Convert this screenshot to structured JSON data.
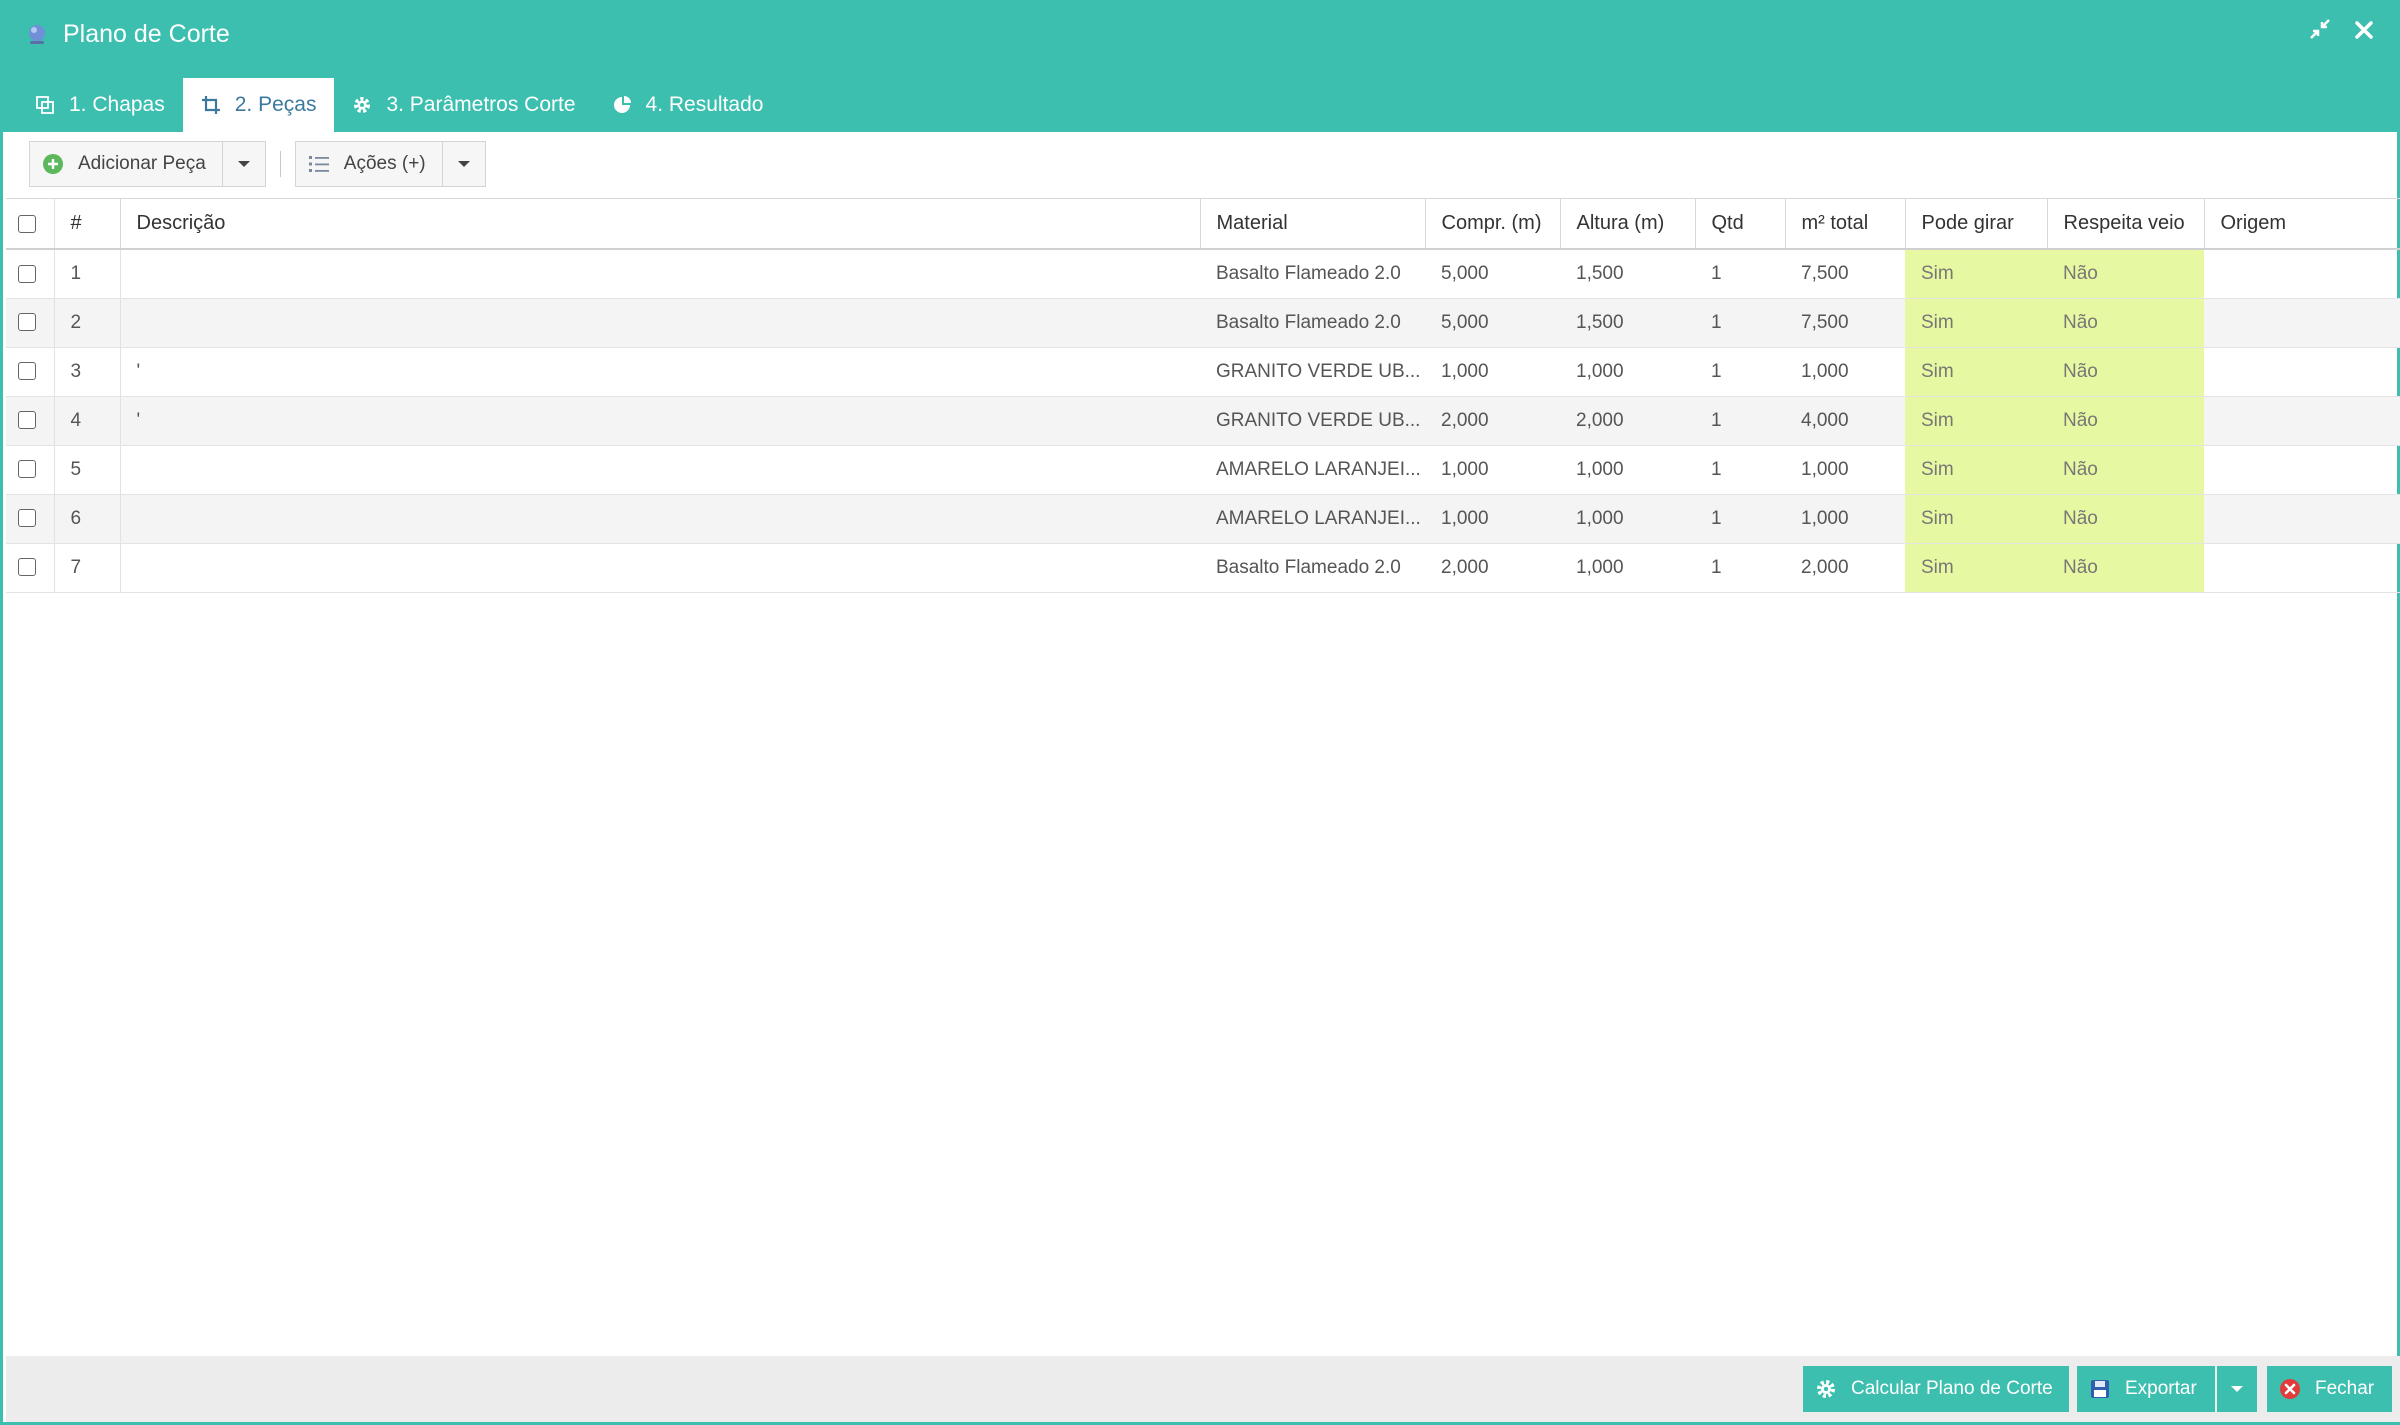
{
  "window": {
    "title": "Plano de Corte",
    "accent_color": "#3dbfb0",
    "icons": [
      "app-icon",
      "compress-icon",
      "close-icon"
    ]
  },
  "tabs": [
    {
      "label": "1. Chapas",
      "icon": "copy-icon"
    },
    {
      "label": "2. Peças",
      "icon": "crop-icon",
      "active": true
    },
    {
      "label": "3. Parâmetros Corte",
      "icon": "gear-icon"
    },
    {
      "label": "4. Resultado",
      "icon": "pie-chart-icon"
    }
  ],
  "toolbar": {
    "add_label": "Adicionar Peça",
    "actions_label": "Ações (+)"
  },
  "table": {
    "columns": [
      "#",
      "Descrição",
      "Material",
      "Compr. (m)",
      "Altura (m)",
      "Qtd",
      "m² total",
      "Pode girar",
      "Respeita veio",
      "Origem"
    ],
    "rows": [
      {
        "n": "1",
        "desc": "",
        "material": "Basalto Flameado 2.0",
        "compr": "5,000",
        "altura": "1,500",
        "qtd": "1",
        "total": "7,500",
        "girar": "Sim",
        "veio": "Não",
        "origem": ""
      },
      {
        "n": "2",
        "desc": "",
        "material": "Basalto Flameado 2.0",
        "compr": "5,000",
        "altura": "1,500",
        "qtd": "1",
        "total": "7,500",
        "girar": "Sim",
        "veio": "Não",
        "origem": ""
      },
      {
        "n": "3",
        "desc": "'",
        "material": "GRANITO VERDE UB...",
        "compr": "1,000",
        "altura": "1,000",
        "qtd": "1",
        "total": "1,000",
        "girar": "Sim",
        "veio": "Não",
        "origem": ""
      },
      {
        "n": "4",
        "desc": "'",
        "material": "GRANITO VERDE UB...",
        "compr": "2,000",
        "altura": "2,000",
        "qtd": "1",
        "total": "4,000",
        "girar": "Sim",
        "veio": "Não",
        "origem": ""
      },
      {
        "n": "5",
        "desc": "",
        "material": "AMARELO LARANJEI...",
        "compr": "1,000",
        "altura": "1,000",
        "qtd": "1",
        "total": "1,000",
        "girar": "Sim",
        "veio": "Não",
        "origem": ""
      },
      {
        "n": "6",
        "desc": "",
        "material": "AMARELO LARANJEI...",
        "compr": "1,000",
        "altura": "1,000",
        "qtd": "1",
        "total": "1,000",
        "girar": "Sim",
        "veio": "Não",
        "origem": ""
      },
      {
        "n": "7",
        "desc": "",
        "material": "Basalto Flameado 2.0",
        "compr": "2,000",
        "altura": "1,000",
        "qtd": "1",
        "total": "2,000",
        "girar": "Sim",
        "veio": "Não",
        "origem": ""
      }
    ]
  },
  "footer": {
    "calc_label": "Calcular Plano de Corte",
    "export_label": "Exportar",
    "close_label": "Fechar"
  }
}
